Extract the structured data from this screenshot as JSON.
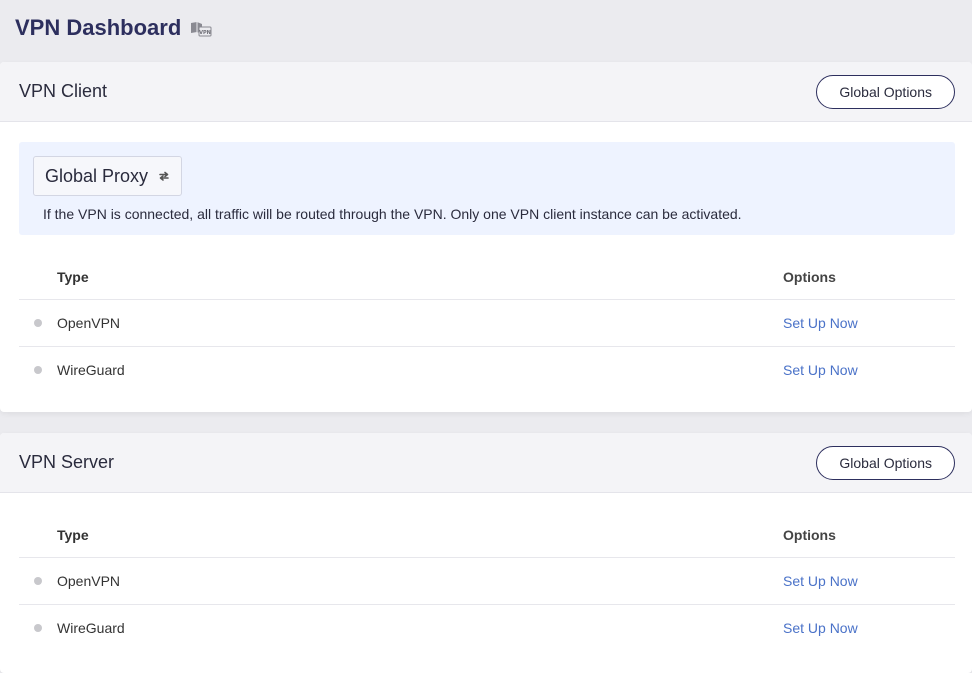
{
  "page": {
    "title": "VPN Dashboard",
    "title_icon": "vpn-badge-icon"
  },
  "client": {
    "title": "VPN Client",
    "global_options_label": "Global Options",
    "proxy_mode": "Global Proxy",
    "proxy_mode_icon": "swap-icon",
    "description": "If the VPN is connected, all traffic will be routed through the VPN. Only one VPN client instance can be activated.",
    "table": {
      "headers": {
        "type": "Type",
        "options": "Options"
      },
      "rows": [
        {
          "type": "OpenVPN",
          "action": "Set Up Now"
        },
        {
          "type": "WireGuard",
          "action": "Set Up Now"
        }
      ]
    }
  },
  "server": {
    "title": "VPN Server",
    "global_options_label": "Global Options",
    "table": {
      "headers": {
        "type": "Type",
        "options": "Options"
      },
      "rows": [
        {
          "type": "OpenVPN",
          "action": "Set Up Now"
        },
        {
          "type": "WireGuard",
          "action": "Set Up Now"
        }
      ]
    }
  },
  "colors": {
    "title": "#2d2f5e",
    "link": "#4a72c8",
    "status_dot": "#c8c8cc",
    "proxy_background": "#eef3ff"
  }
}
